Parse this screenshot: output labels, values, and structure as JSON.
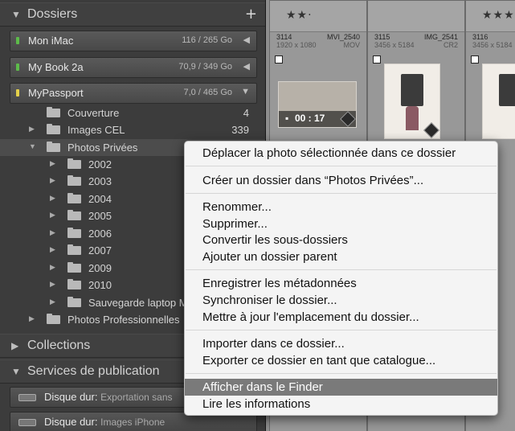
{
  "panels": {
    "dossiers": {
      "title": "Dossiers",
      "add": "+"
    },
    "collections": {
      "title": "Collections"
    },
    "services": {
      "title": "Services de publication"
    }
  },
  "volumes": [
    {
      "name": "Mon iMac",
      "capacity": "116 / 265 Go",
      "led": "#5dbb4a"
    },
    {
      "name": "My Book 2a",
      "capacity": "70,9 / 349 Go",
      "led": "#5dbb4a"
    },
    {
      "name": "MyPassport",
      "capacity": "7,0 / 465 Go",
      "led": "#e4d14a"
    }
  ],
  "folders": [
    {
      "label": "Couverture",
      "count": "4"
    },
    {
      "label": "Images CEL",
      "count": "339"
    },
    {
      "label": "Photos Privées",
      "count": ""
    },
    {
      "label": "2002"
    },
    {
      "label": "2003"
    },
    {
      "label": "2004"
    },
    {
      "label": "2005"
    },
    {
      "label": "2006"
    },
    {
      "label": "2007"
    },
    {
      "label": "2009"
    },
    {
      "label": "2010"
    },
    {
      "label": "Sauvegarde laptop M"
    },
    {
      "label": "Photos Professionnelles"
    }
  ],
  "services": [
    {
      "name": "Disque dur",
      "sub": "Exportation sans"
    },
    {
      "name": "Disque dur",
      "sub": "Images iPhone"
    }
  ],
  "grid": [
    {
      "stars": "★★·",
      "num": "3114",
      "dims": "1920 x 1080",
      "file": "MVI_2540",
      "ext": "MOV",
      "duration": "00 : 17"
    },
    {
      "stars": "",
      "num": "3115",
      "dims": "3456 x 5184",
      "file": "IMG_2541",
      "ext": "CR2"
    },
    {
      "stars": "★★★",
      "num": "3116",
      "dims": "3456 x 5184",
      "file": "",
      "ext": ""
    }
  ],
  "menu": {
    "items": [
      "Déplacer la photo sélectionnée dans ce dossier",
      "Créer un dossier dans “Photos Privées”...",
      "Renommer...",
      "Supprimer...",
      "Convertir les sous-dossiers",
      "Ajouter un dossier parent",
      "Enregistrer les métadonnées",
      "Synchroniser le dossier...",
      "Mettre à jour l'emplacement du dossier...",
      "Importer dans ce dossier...",
      "Exporter ce dossier en tant que catalogue...",
      "Afficher dans le Finder",
      "Lire les informations"
    ],
    "highlighted_item": "Afficher dans le Finder"
  }
}
